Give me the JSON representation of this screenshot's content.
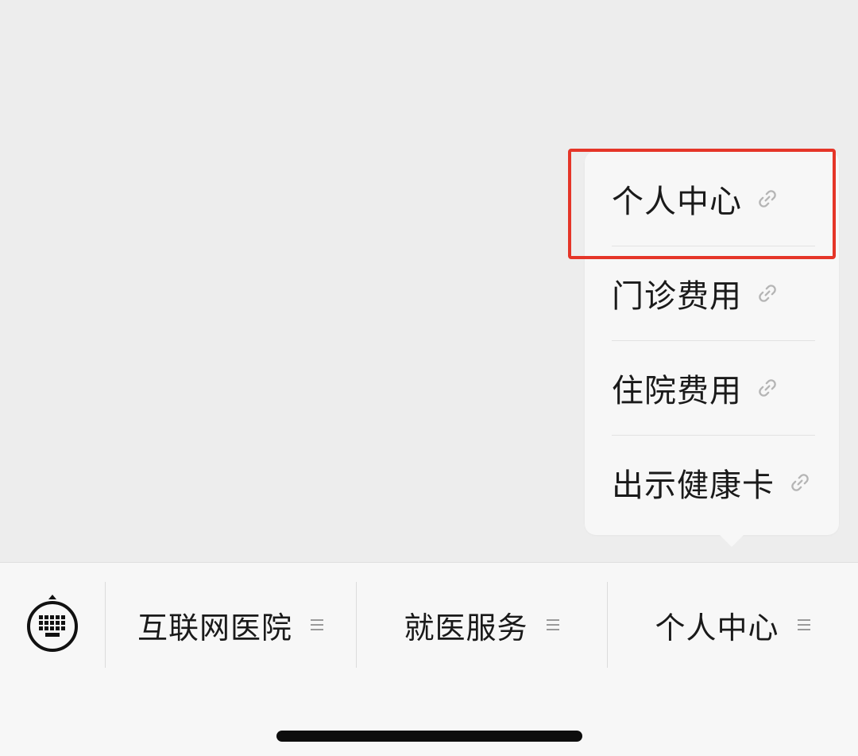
{
  "submenu": {
    "items": [
      {
        "label": "个人中心",
        "icon": "link-icon"
      },
      {
        "label": "门诊费用",
        "icon": "link-icon"
      },
      {
        "label": "住院费用",
        "icon": "link-icon"
      },
      {
        "label": "出示健康卡",
        "icon": "link-icon"
      }
    ],
    "highlighted_item": "个人中心",
    "highlight_color": "#e53528"
  },
  "menu_bar": {
    "keyboard_icon": "keyboard-icon",
    "items": [
      {
        "label": "互联网医院",
        "icon": "menu-lines-icon"
      },
      {
        "label": "就医服务",
        "icon": "menu-lines-icon"
      },
      {
        "label": "个人中心",
        "icon": "menu-lines-icon"
      }
    ]
  },
  "colors": {
    "background": "#ededed",
    "bar_background": "#f7f7f7",
    "text": "#1a1a1a",
    "highlight": "#e53528"
  }
}
